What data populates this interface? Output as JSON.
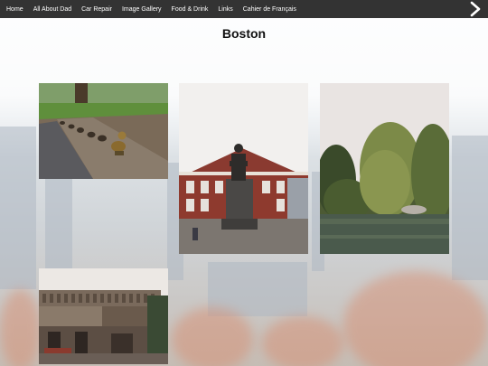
{
  "nav": {
    "items": [
      {
        "label": "Home"
      },
      {
        "label": "All About Dad"
      },
      {
        "label": "Car Repair"
      },
      {
        "label": "Image Gallery"
      },
      {
        "label": "Food & Drink"
      },
      {
        "label": "Links"
      },
      {
        "label": "Cahier de Français"
      }
    ],
    "next_icon": "chevron-right-icon"
  },
  "page": {
    "title": "Boston"
  },
  "gallery": {
    "photos": [
      {
        "subject": "make-way-for-ducklings-statue"
      },
      {
        "subject": "faneuil-hall-samuel-adams-statue"
      },
      {
        "subject": "public-garden-pond-willow"
      },
      {
        "subject": "boston-city-hall"
      }
    ]
  },
  "colors": {
    "nav_bg": "#333333",
    "nav_text": "#ffffff",
    "title_text": "#111111"
  }
}
